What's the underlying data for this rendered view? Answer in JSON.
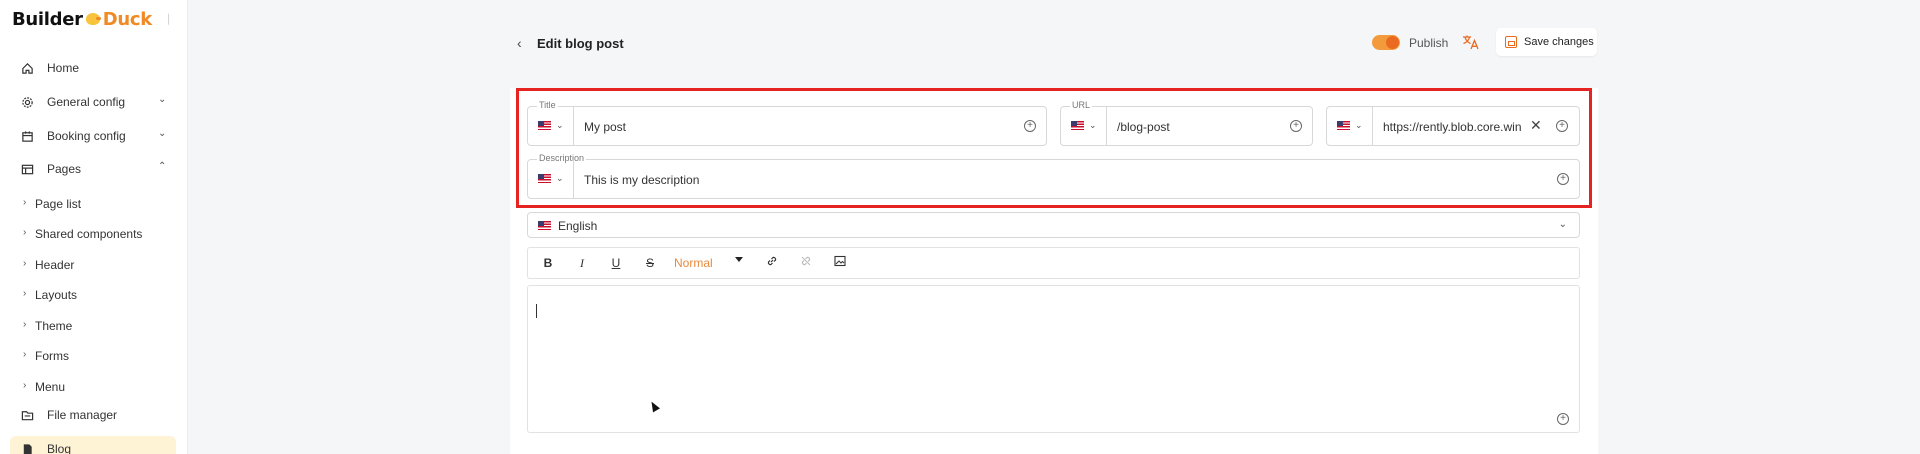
{
  "brand": {
    "name_part1": "Builder",
    "name_part2": "Duck"
  },
  "sidebar": {
    "items": [
      {
        "label": "Home"
      },
      {
        "label": "General config"
      },
      {
        "label": "Booking config"
      },
      {
        "label": "Pages"
      },
      {
        "label": "File manager"
      },
      {
        "label": "Blog"
      }
    ],
    "pages_subitems": [
      {
        "label": "Page list"
      },
      {
        "label": "Shared components"
      },
      {
        "label": "Header"
      },
      {
        "label": "Layouts"
      },
      {
        "label": "Theme"
      },
      {
        "label": "Forms"
      },
      {
        "label": "Menu"
      }
    ]
  },
  "header": {
    "back_icon": "chevron-left-icon",
    "title": "Edit blog post",
    "publish_label": "Publish",
    "publish_on": true,
    "save_label": "Save changes"
  },
  "form": {
    "title": {
      "label": "Title",
      "value": "My post"
    },
    "url": {
      "label": "URL",
      "value": "/blog-post"
    },
    "image_url": {
      "value": "https://rently.blob.core.win"
    },
    "description": {
      "label": "Description",
      "value": "This is my description"
    }
  },
  "language_select": {
    "value": "English"
  },
  "toolbar": {
    "bold": "B",
    "italic": "I",
    "underline": "U",
    "strike": "S",
    "format": "Normal"
  },
  "colors": {
    "accent": "#ea6a1f",
    "highlight": "#e52421",
    "active_nav": "#fff3d6"
  }
}
